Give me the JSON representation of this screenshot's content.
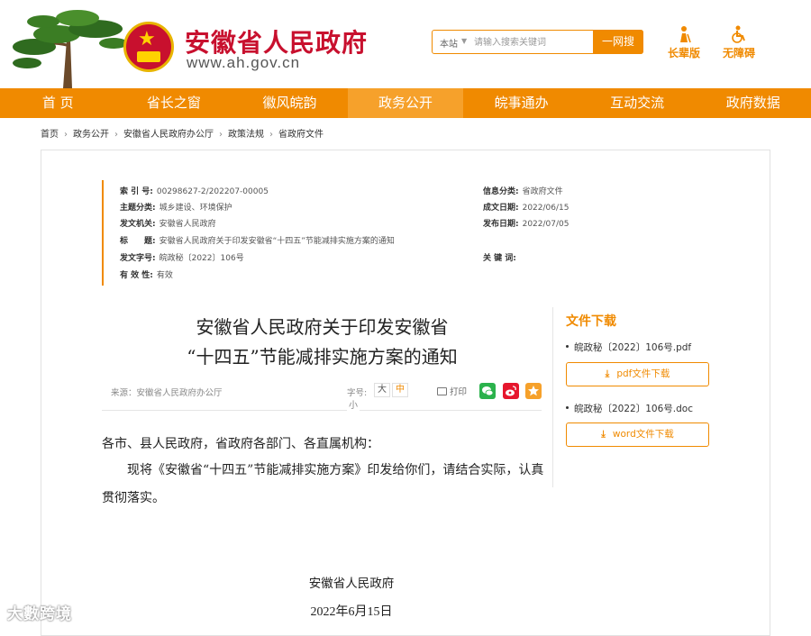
{
  "header": {
    "site_title": "安徽省人民政府",
    "site_url": "www.ah.gov.cn",
    "search": {
      "scope": "本站",
      "placeholder": "请输入搜索关键词",
      "button": "一网搜"
    },
    "tools": {
      "elder": "长辈版",
      "accessible": "无障碍"
    }
  },
  "nav": {
    "items": [
      "首 页",
      "省长之窗",
      "徽风皖韵",
      "政务公开",
      "皖事通办",
      "互动交流",
      "政府数据"
    ],
    "active_index": 3
  },
  "breadcrumb": [
    "首页",
    "政务公开",
    "安徽省人民政府办公厅",
    "政策法规",
    "省政府文件"
  ],
  "meta": {
    "index_no": {
      "k": "索 引 号:",
      "v": "00298627-2/202207-00005"
    },
    "topic": {
      "k": "主题分类:",
      "v": "城乡建设、环境保护"
    },
    "issuer": {
      "k": "发文机关:",
      "v": "安徽省人民政府"
    },
    "title": {
      "k": "标　　题:",
      "v": "安徽省人民政府关于印发安徽省“十四五”节能减排实施方案的通知"
    },
    "doc_no": {
      "k": "发文字号:",
      "v": "皖政秘〔2022〕106号"
    },
    "validity": {
      "k": "有 效 性:",
      "v": "有效"
    },
    "info_class": {
      "k": "信息分类:",
      "v": "省政府文件"
    },
    "written_date": {
      "k": "成文日期:",
      "v": "2022/06/15"
    },
    "publish_date": {
      "k": "发布日期:",
      "v": "2022/07/05"
    },
    "keywords": {
      "k": "关 键 词:",
      "v": ""
    }
  },
  "article": {
    "title_line1": "安徽省人民政府关于印发安徽省",
    "title_line2": "“十四五”节能减排实施方案的通知",
    "source": "来源：安徽省人民政府办公厅",
    "font_size_label": "字号:",
    "font_big": "大",
    "font_mid": "中",
    "font_small": "小",
    "print": "打印",
    "salutation": "各市、县人民政府，省政府各部门、各直属机构：",
    "paragraph": "现将《安徽省“十四五”节能减排实施方案》印发给你们，请结合实际，认真贯彻落实。",
    "signer": "安徽省人民政府",
    "date": "2022年6月15日"
  },
  "downloads": {
    "title": "文件下载",
    "files": [
      {
        "name": "皖政秘〔2022〕106号.pdf",
        "button": "pdf文件下载"
      },
      {
        "name": "皖政秘〔2022〕106号.doc",
        "button": "word文件下载"
      }
    ]
  },
  "watermark": "大數跨境",
  "colors": {
    "brand_red": "#c8102e",
    "accent_orange": "#f08a00"
  }
}
